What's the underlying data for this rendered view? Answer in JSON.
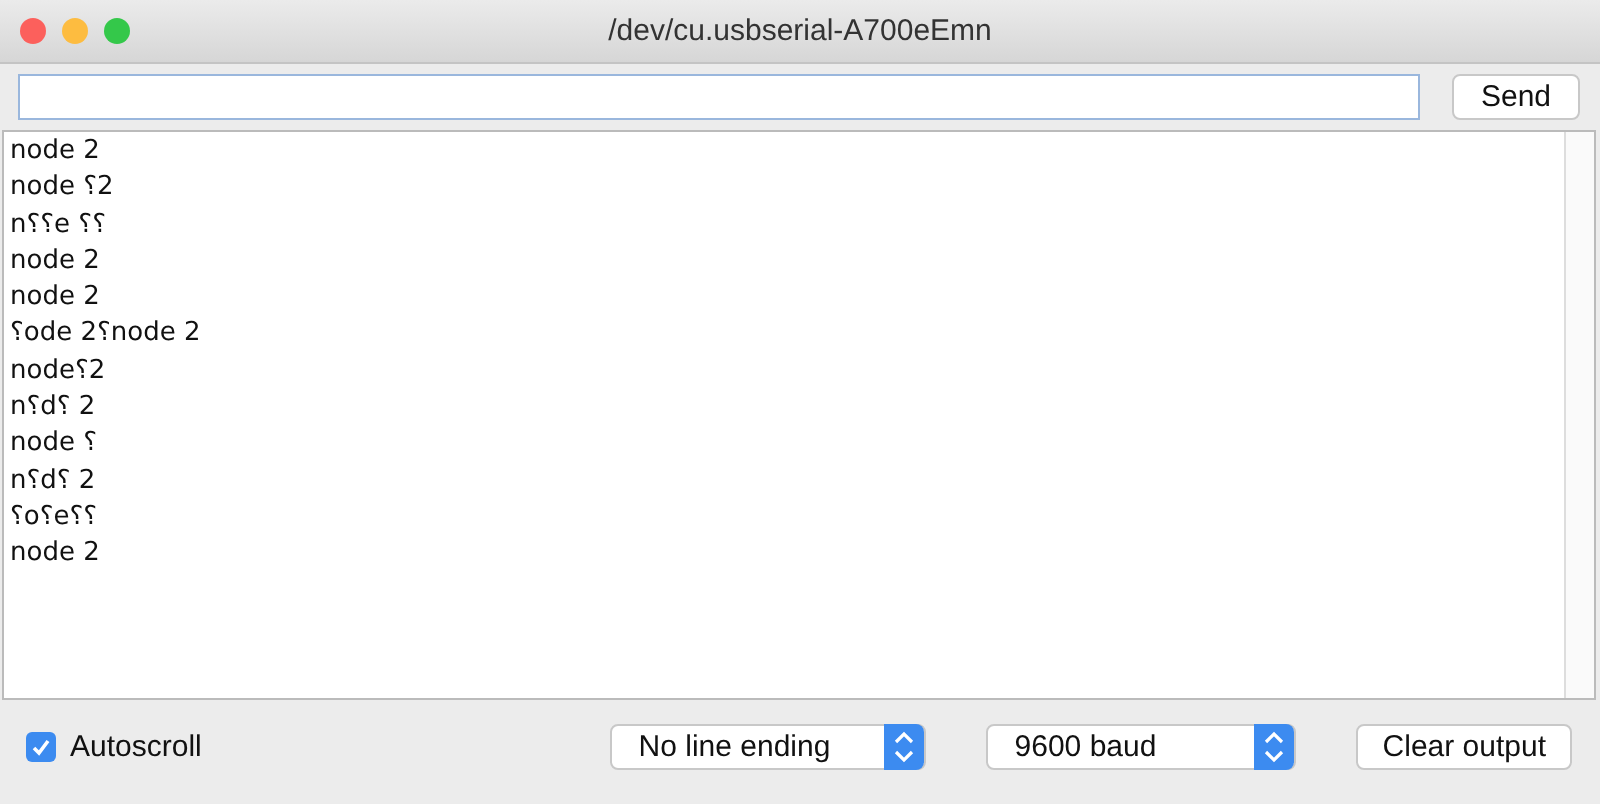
{
  "window": {
    "title": "/dev/cu.usbserial-A700eEmn"
  },
  "send_button": "Send",
  "output_lines": [
    "node 2",
    "node ⸮2",
    "n⸮⸮e ⸮⸮",
    "node 2",
    "node 2",
    "⸮ode 2⸮node 2",
    "node⸮2",
    "n⸮d⸮ 2",
    "node ⸮",
    "n⸮d⸮ 2",
    "⸮o⸮e⸮⸮",
    "node 2"
  ],
  "autoscroll": {
    "label": "Autoscroll",
    "checked": true
  },
  "line_ending": {
    "value": "No line ending"
  },
  "baud": {
    "value": "9600 baud"
  },
  "clear_button": "Clear output"
}
